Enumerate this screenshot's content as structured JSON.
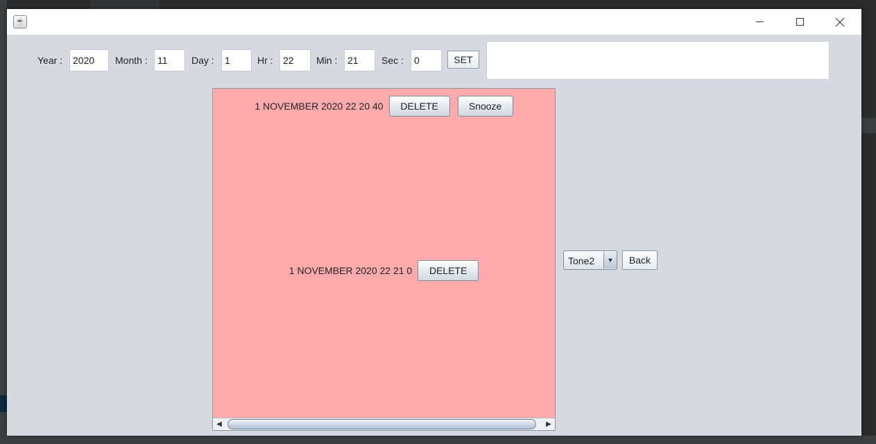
{
  "window": {
    "title": "",
    "icon": "java-coffee-icon",
    "controls": {
      "minimize": "minimize-icon",
      "maximize": "maximize-icon",
      "close": "close-icon"
    }
  },
  "form": {
    "year_label": "Year :",
    "year_value": "2020",
    "month_label": "Month :",
    "month_value": "11",
    "day_label": "Day :",
    "day_value": "1",
    "hour_label": "Hr :",
    "hour_value": "22",
    "minute_label": "Min :",
    "minute_value": "21",
    "second_label": "Sec :",
    "second_value": "0",
    "set_label": "SET",
    "status_text": ""
  },
  "alarms": [
    {
      "text": "1 NOVEMBER 2020 22 20 40",
      "delete_label": "DELETE",
      "snooze_label": "Snooze"
    },
    {
      "text": "1 NOVEMBER 2020 22 21 0",
      "delete_label": "DELETE"
    }
  ],
  "list_background": "#ffabad",
  "tone": {
    "selected": "Tone2"
  },
  "back_label": "Back"
}
